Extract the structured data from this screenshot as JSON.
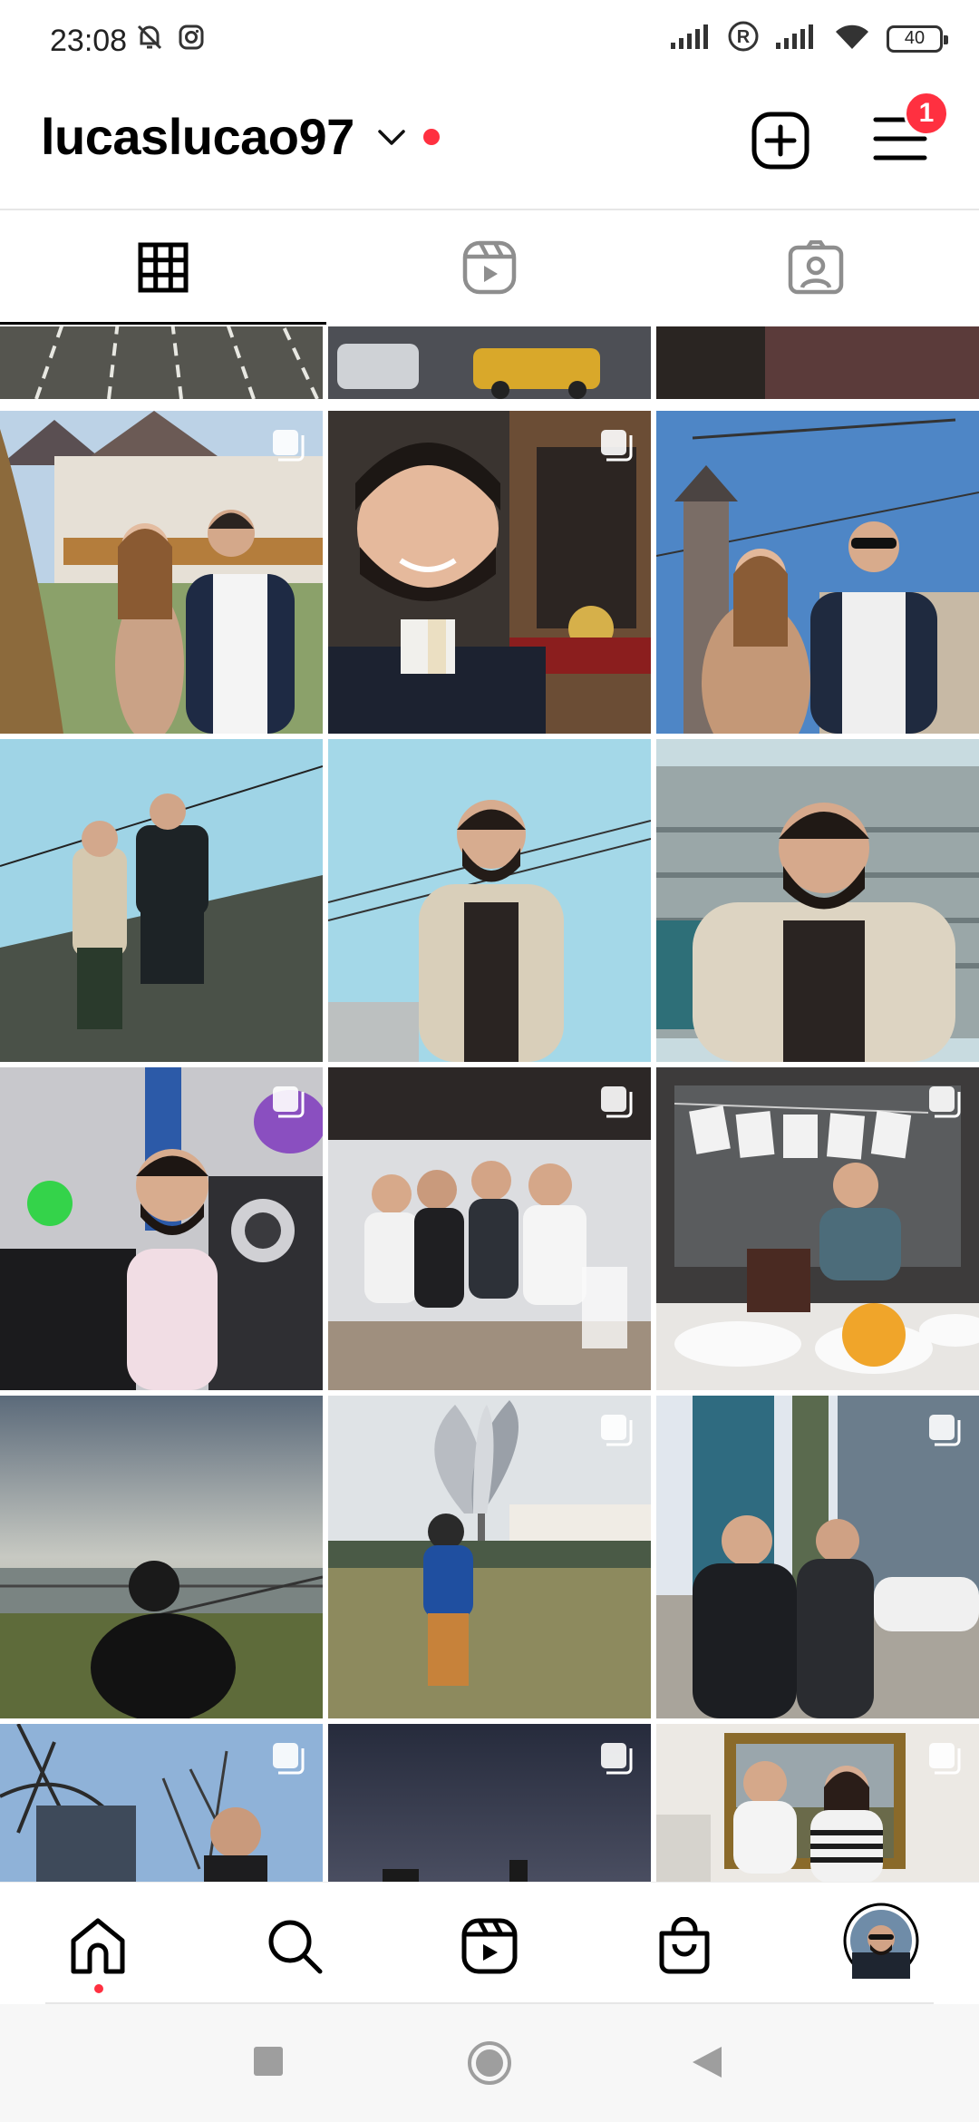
{
  "status_bar": {
    "time": "23:08",
    "battery_level": "40",
    "icons": [
      "mute-icon",
      "instagram-icon",
      "signal-icon",
      "roaming-r-icon",
      "signal-icon",
      "wifi-icon",
      "battery-icon"
    ]
  },
  "header": {
    "username": "lucaslucao97",
    "notifications_badge": "1",
    "icons": [
      "chevron-down-icon",
      "new-post-icon",
      "menu-icon"
    ],
    "accent_color": "#ff3040"
  },
  "tabs": [
    {
      "name": "posts-grid",
      "icon": "grid-icon",
      "active": true
    },
    {
      "name": "reels",
      "icon": "reels-icon",
      "active": false
    },
    {
      "name": "tagged",
      "icon": "tagged-icon",
      "active": false
    }
  ],
  "grid": {
    "rows": [
      [
        {
          "title": "road with parking lines",
          "multi": false
        },
        {
          "title": "street with yellow taxi",
          "multi": false
        },
        {
          "title": "dark wall",
          "multi": false
        }
      ],
      [
        {
          "title": "couple in front of half-timbered house",
          "multi": true
        },
        {
          "title": "smiling man with beard",
          "multi": true
        },
        {
          "title": "couple in front of clock tower",
          "multi": false
        }
      ],
      [
        {
          "title": "two men sitting on wall",
          "multi": false
        },
        {
          "title": "man in beige jacket",
          "multi": false
        },
        {
          "title": "man in beige jacket close up",
          "multi": false
        }
      ],
      [
        {
          "title": "man at computer desk",
          "multi": true
        },
        {
          "title": "group of friends",
          "multi": true
        },
        {
          "title": "birthday party table",
          "multi": true
        }
      ],
      [
        {
          "title": "man by the river",
          "multi": false
        },
        {
          "title": "man before metal flower sculpture",
          "multi": true
        },
        {
          "title": "two men by skyscrapers",
          "multi": true
        }
      ],
      [
        {
          "title": "trees and building",
          "multi": true
        },
        {
          "title": "night sky",
          "multi": true
        },
        {
          "title": "couple with painting",
          "multi": true
        }
      ]
    ]
  },
  "bottom_nav": [
    {
      "name": "home",
      "icon": "home-icon",
      "active": true
    },
    {
      "name": "search",
      "icon": "search-icon",
      "active": false
    },
    {
      "name": "reels",
      "icon": "reels-icon",
      "active": false
    },
    {
      "name": "shop",
      "icon": "shop-bag-icon",
      "active": false
    },
    {
      "name": "profile",
      "icon": "profile-avatar",
      "active": false
    }
  ],
  "system_nav": [
    "recents-square-icon",
    "home-circle-icon",
    "back-triangle-icon"
  ]
}
